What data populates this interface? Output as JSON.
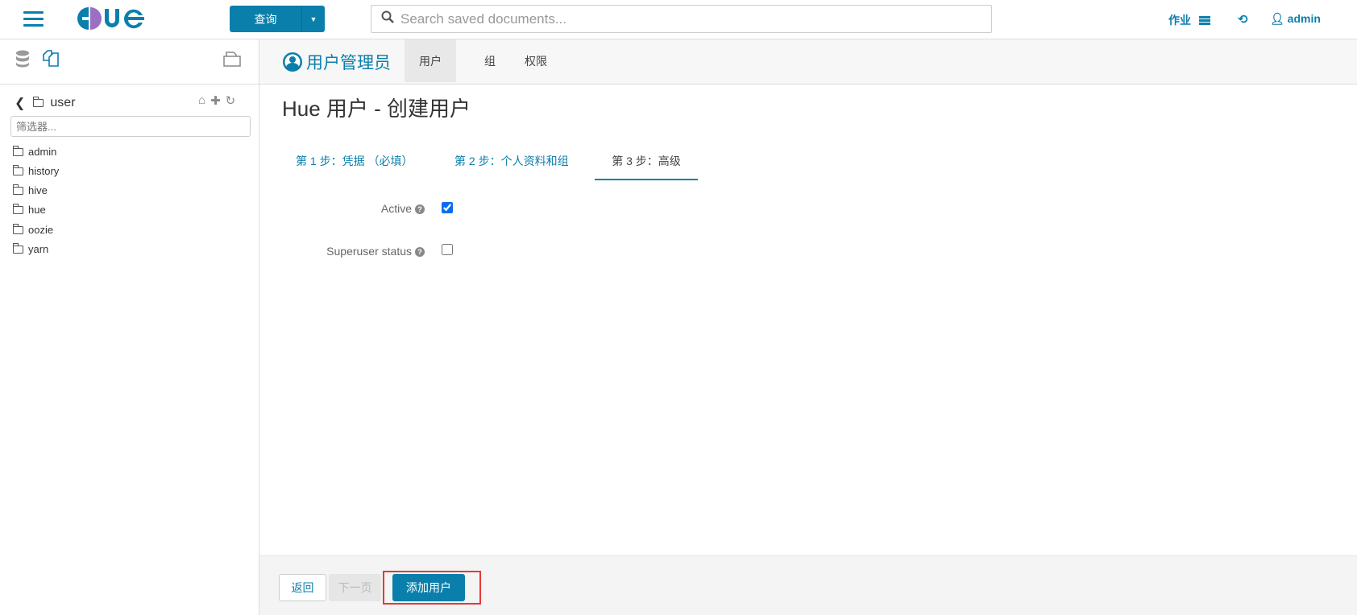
{
  "header": {
    "logo": "HUE",
    "query_button": "查询",
    "search_placeholder": "Search saved documents...",
    "jobs_label": "作业",
    "user": "admin"
  },
  "sidebar": {
    "folder": "user",
    "filter_placeholder": "筛选器...",
    "items": [
      "admin",
      "history",
      "hive",
      "hue",
      "oozie",
      "yarn"
    ]
  },
  "nav": {
    "app_title": "用户管理员",
    "tabs": [
      "用户",
      "组",
      "权限"
    ],
    "active_tab": "用户"
  },
  "page": {
    "title": "Hue 用户 - 创建用户",
    "steps": [
      "第 1 步：凭据 （必填）",
      "第 2 步：个人资料和组",
      "第 3 步：高级"
    ],
    "active_step": 2,
    "fields": [
      {
        "label": "Active",
        "checked": true
      },
      {
        "label": "Superuser status",
        "checked": false
      }
    ]
  },
  "footer": {
    "back": "返回",
    "next": "下一页",
    "add_user": "添加用户"
  },
  "colors": {
    "accent": "#0b7fab",
    "highlight": "#e53935"
  }
}
